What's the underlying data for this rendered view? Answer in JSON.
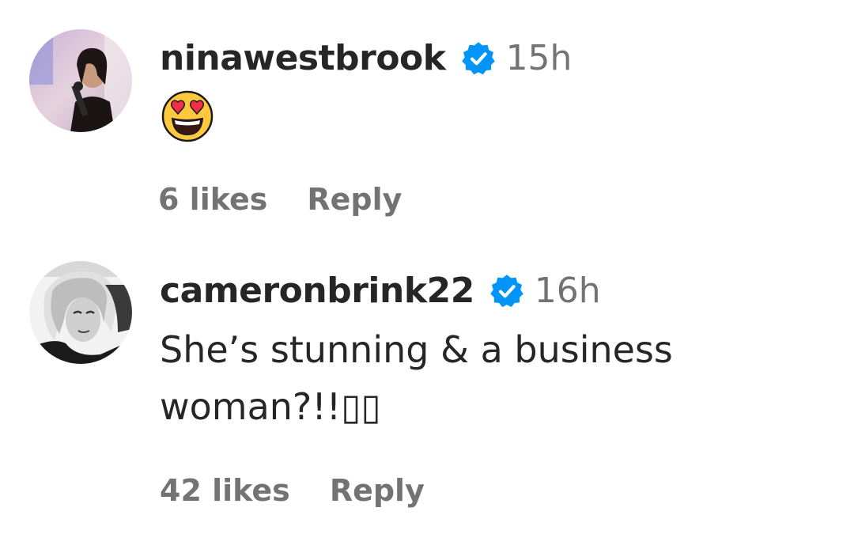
{
  "comments": [
    {
      "username": "ninawestbrook",
      "verified": true,
      "time": "15h",
      "text": "",
      "emoji": "heart-eyes-emoji",
      "likes": "6 likes",
      "reply_label": "Reply",
      "avatar": "avatar-photo-woman-with-microphone"
    },
    {
      "username": "cameronbrink22",
      "verified": true,
      "time": "16h",
      "text_line1": "She’s stunning & a business",
      "text_line2": "woman?!!▯▯",
      "likes": "42 likes",
      "reply_label": "Reply",
      "avatar": "avatar-photo-black-and-white-portrait"
    }
  ],
  "colors": {
    "text": "#262626",
    "secondary": "#737373",
    "verified_blue": "#0095f6",
    "background": "#ffffff"
  }
}
